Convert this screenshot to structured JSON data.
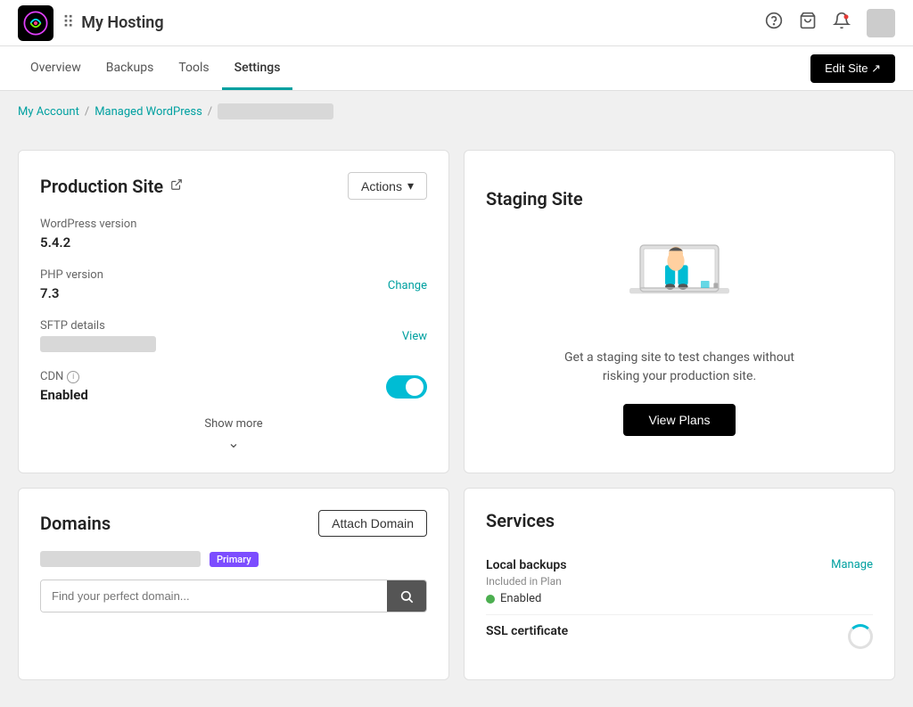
{
  "topbar": {
    "title": "My Hosting",
    "logo_alt": "brand-logo",
    "grid_icon": "⊞",
    "help_icon": "?",
    "cart_icon": "🛒",
    "bell_icon": "🔔"
  },
  "navbar": {
    "items": [
      {
        "label": "Overview",
        "active": false
      },
      {
        "label": "Backups",
        "active": false
      },
      {
        "label": "Tools",
        "active": false
      },
      {
        "label": "Settings",
        "active": true
      }
    ],
    "edit_site_btn": "Edit Site ↗"
  },
  "breadcrumb": {
    "my_account": "My Account",
    "managed_wp": "Managed WordPress",
    "separator": "/"
  },
  "production_site": {
    "title": "Production Site",
    "external_icon": "↗",
    "actions_label": "Actions",
    "wp_version_label": "WordPress version",
    "wp_version_value": "5.4.2",
    "php_version_label": "PHP version",
    "php_version_value": "7.3",
    "php_change_link": "Change",
    "sftp_label": "SFTP details",
    "sftp_view_link": "View",
    "cdn_label": "CDN",
    "cdn_value": "Enabled",
    "cdn_enabled": true,
    "show_more_label": "Show more"
  },
  "staging_site": {
    "title": "Staging Site",
    "description": "Get a staging site to test changes without risking your production site.",
    "view_plans_btn": "View Plans"
  },
  "domains": {
    "title": "Domains",
    "attach_domain_btn": "Attach Domain",
    "primary_badge": "Primary",
    "search_placeholder": "Find your perfect domain..."
  },
  "services": {
    "title": "Services",
    "local_backups": {
      "name": "Local backups",
      "sub": "Included in Plan",
      "status": "Enabled",
      "manage_link": "Manage"
    },
    "ssl_certificate": {
      "name": "SSL certificate"
    }
  }
}
